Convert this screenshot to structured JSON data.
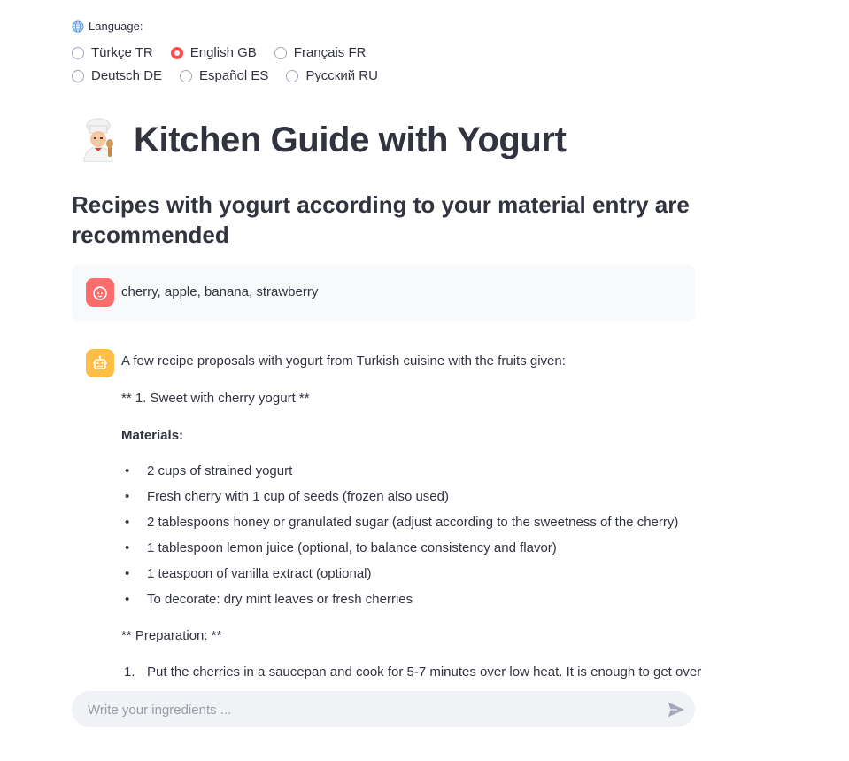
{
  "language": {
    "label": "Language:",
    "options": [
      {
        "label": "Türkçe TR",
        "selected": false
      },
      {
        "label": "English GB",
        "selected": true
      },
      {
        "label": "Français FR",
        "selected": false
      },
      {
        "label": "Deutsch DE",
        "selected": false
      },
      {
        "label": "Español ES",
        "selected": false
      },
      {
        "label": "Русский RU",
        "selected": false
      }
    ]
  },
  "page": {
    "title": "Kitchen Guide with Yogurt",
    "subtitle": "Recipes with yogurt according to your material entry are recommended"
  },
  "chat": {
    "user_message": "cherry, apple, banana, strawberry",
    "assistant": {
      "intro": "A few recipe proposals with yogurt from Turkish cuisine with the fruits given:",
      "recipe_heading": "** 1. Sweet with cherry yogurt **",
      "materials_heading": "Materials:",
      "materials": [
        "2 cups of strained yogurt",
        "Fresh cherry with 1 cup of seeds (frozen also used)",
        "2 tablespoons honey or granulated sugar (adjust according to the sweetness of the cherry)",
        "1 tablespoon lemon juice (optional, to balance consistency and flavor)",
        "1 teaspoon of vanilla extract (optional)",
        "To decorate: dry mint leaves or fresh cherries"
      ],
      "preparation_heading": "** Preparation: **",
      "steps": [
        {
          "num": "1.",
          "text": "Put the cherries in a saucepan and cook for 5-7 minutes over low heat. It is enough to get over"
        }
      ]
    }
  },
  "input": {
    "placeholder": "Write your ingredients ..."
  },
  "colors": {
    "accent": "#ff4b4b",
    "user_avatar": "#ff6c6c",
    "bot_avatar": "#ffbd45"
  }
}
